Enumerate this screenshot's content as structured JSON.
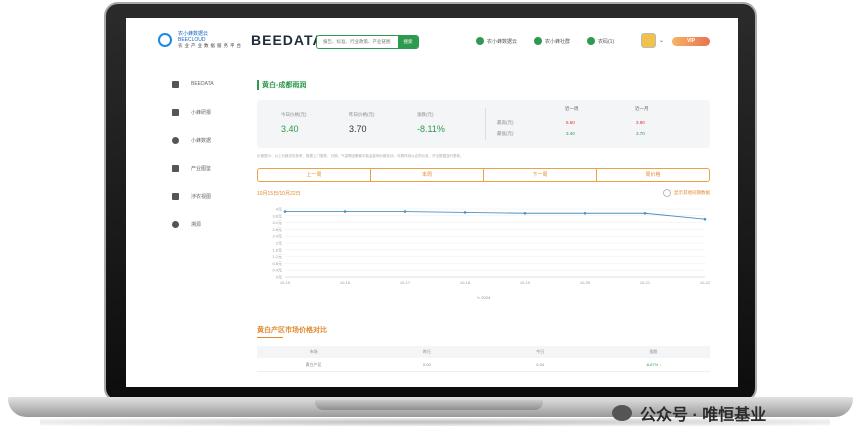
{
  "header": {
    "logo_sub": "农小蜂数据云",
    "logo_en": "BEECLOUD",
    "logo_tag": "农业产业数据服务平台",
    "logo_text": "BEEDATA",
    "search_placeholder": "报告、标准、行业政策、产业链图",
    "search_button": "搜索",
    "nav": [
      {
        "label": "农小蜂数据云",
        "icon": "leaf-icon"
      },
      {
        "label": "农小蜂社群",
        "icon": "group-icon"
      },
      {
        "label": "农码(1)",
        "icon": "code-icon"
      }
    ],
    "vip_label": "VIP"
  },
  "sidebar": {
    "items": [
      {
        "label": "BEEDATA",
        "icon": "home-icon"
      },
      {
        "label": "小蜂研报",
        "icon": "report-icon"
      },
      {
        "label": "小蜂数据",
        "icon": "cloud-icon"
      },
      {
        "label": "产业图鉴",
        "icon": "book-icon"
      },
      {
        "label": "涉农视图",
        "icon": "grid-icon"
      },
      {
        "label": "溯源",
        "icon": "globe-icon"
      }
    ]
  },
  "page": {
    "title": "黄白-成都雨润",
    "price": {
      "today_label": "今日价格(元)",
      "today_value": "3.40",
      "yesterday_label": "昨日价格(元)",
      "yesterday_value": "3.70",
      "change_label": "涨跌(元)",
      "change_value": "-8.11%"
    },
    "range": {
      "week_label": "近一周",
      "month_label": "近一月",
      "high_label": "最高(元)",
      "low_label": "最低(元)",
      "week_high": "5.50",
      "week_low": "3.40",
      "month_high": "3.90",
      "month_low": "3.70"
    },
    "note": "价格提示：以上价格仅供参考，数据上门更新，日期，气温等因素都可能会影响价格变动，可期时段以合同为准，开出数据及时更新。",
    "tabs": [
      "上一周",
      "本周",
      "下一周",
      "周价格"
    ],
    "date_range": "10月15日/10月22日",
    "toggle_label": "显示其他同期数据"
  },
  "chart_data": {
    "type": "line",
    "x": [
      "10-15",
      "10-16",
      "10-17",
      "10-18",
      "10-19",
      "10-20",
      "10-21",
      "10-22"
    ],
    "series": [
      {
        "values": [
          3.85,
          3.85,
          3.85,
          3.8,
          3.75,
          3.75,
          3.75,
          3.4
        ]
      }
    ],
    "ytick_labels": [
      "4元",
      "3.6元",
      "3.2元",
      "2.8元",
      "2.4元",
      "2元",
      "1.6元",
      "1.2元",
      "0.8元",
      "0.4元",
      "0元"
    ],
    "ylim": [
      0,
      4
    ],
    "legend": "2024",
    "grid": true,
    "color": "#4a90c2"
  },
  "compare": {
    "title": "黄白产区市场价格对比",
    "headers": [
      "市场",
      "昨日",
      "今日",
      "涨跌"
    ],
    "rows": [
      [
        "黄白产区",
        "0.00",
        "0.34",
        "-8.67%"
      ]
    ]
  },
  "watermark": {
    "text": "公众号 · 唯恒基业"
  },
  "colors": {
    "green": "#2e9a4f",
    "orange": "#e08a2d",
    "red": "#d9342b"
  }
}
